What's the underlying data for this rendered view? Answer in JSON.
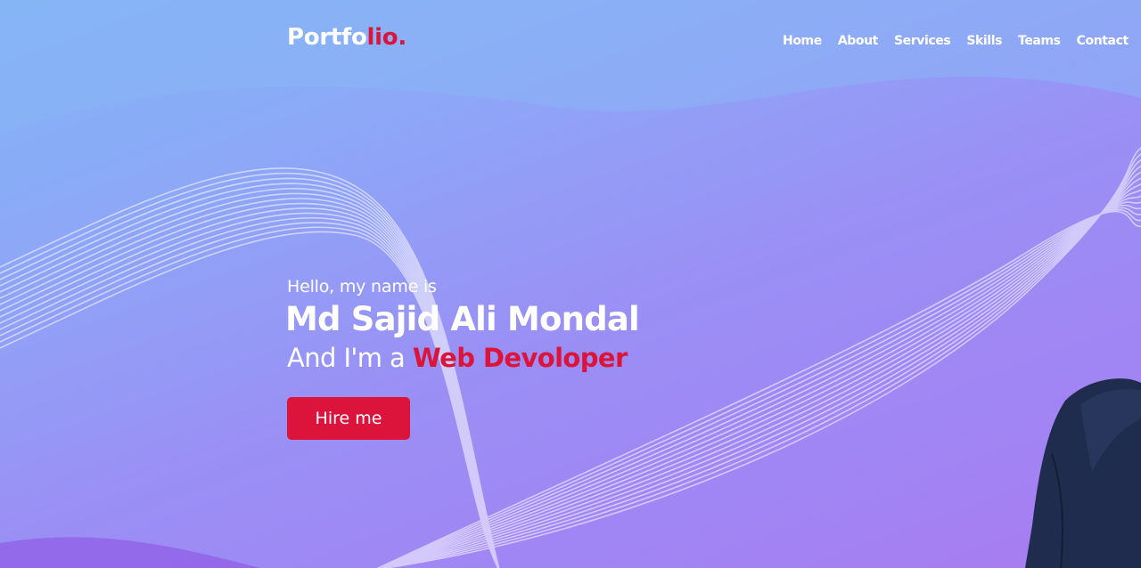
{
  "navbar": {
    "logo_main": "Portfo",
    "logo_accent": "lio.",
    "menu": [
      {
        "label": "Home"
      },
      {
        "label": "About"
      },
      {
        "label": "Services"
      },
      {
        "label": "Skills"
      },
      {
        "label": "Teams"
      },
      {
        "label": "Contact"
      }
    ]
  },
  "hero": {
    "greeting": "Hello, my name is",
    "name": "Md Sajid Ali Mondal",
    "role_prefix": "And I'm a ",
    "role": "Web Devoloper",
    "cta_label": "Hire me"
  },
  "colors": {
    "accent": "#dc143c",
    "text": "#ffffff",
    "bg_top": "#7fb6f5",
    "bg_bottom": "#a77cf2"
  }
}
